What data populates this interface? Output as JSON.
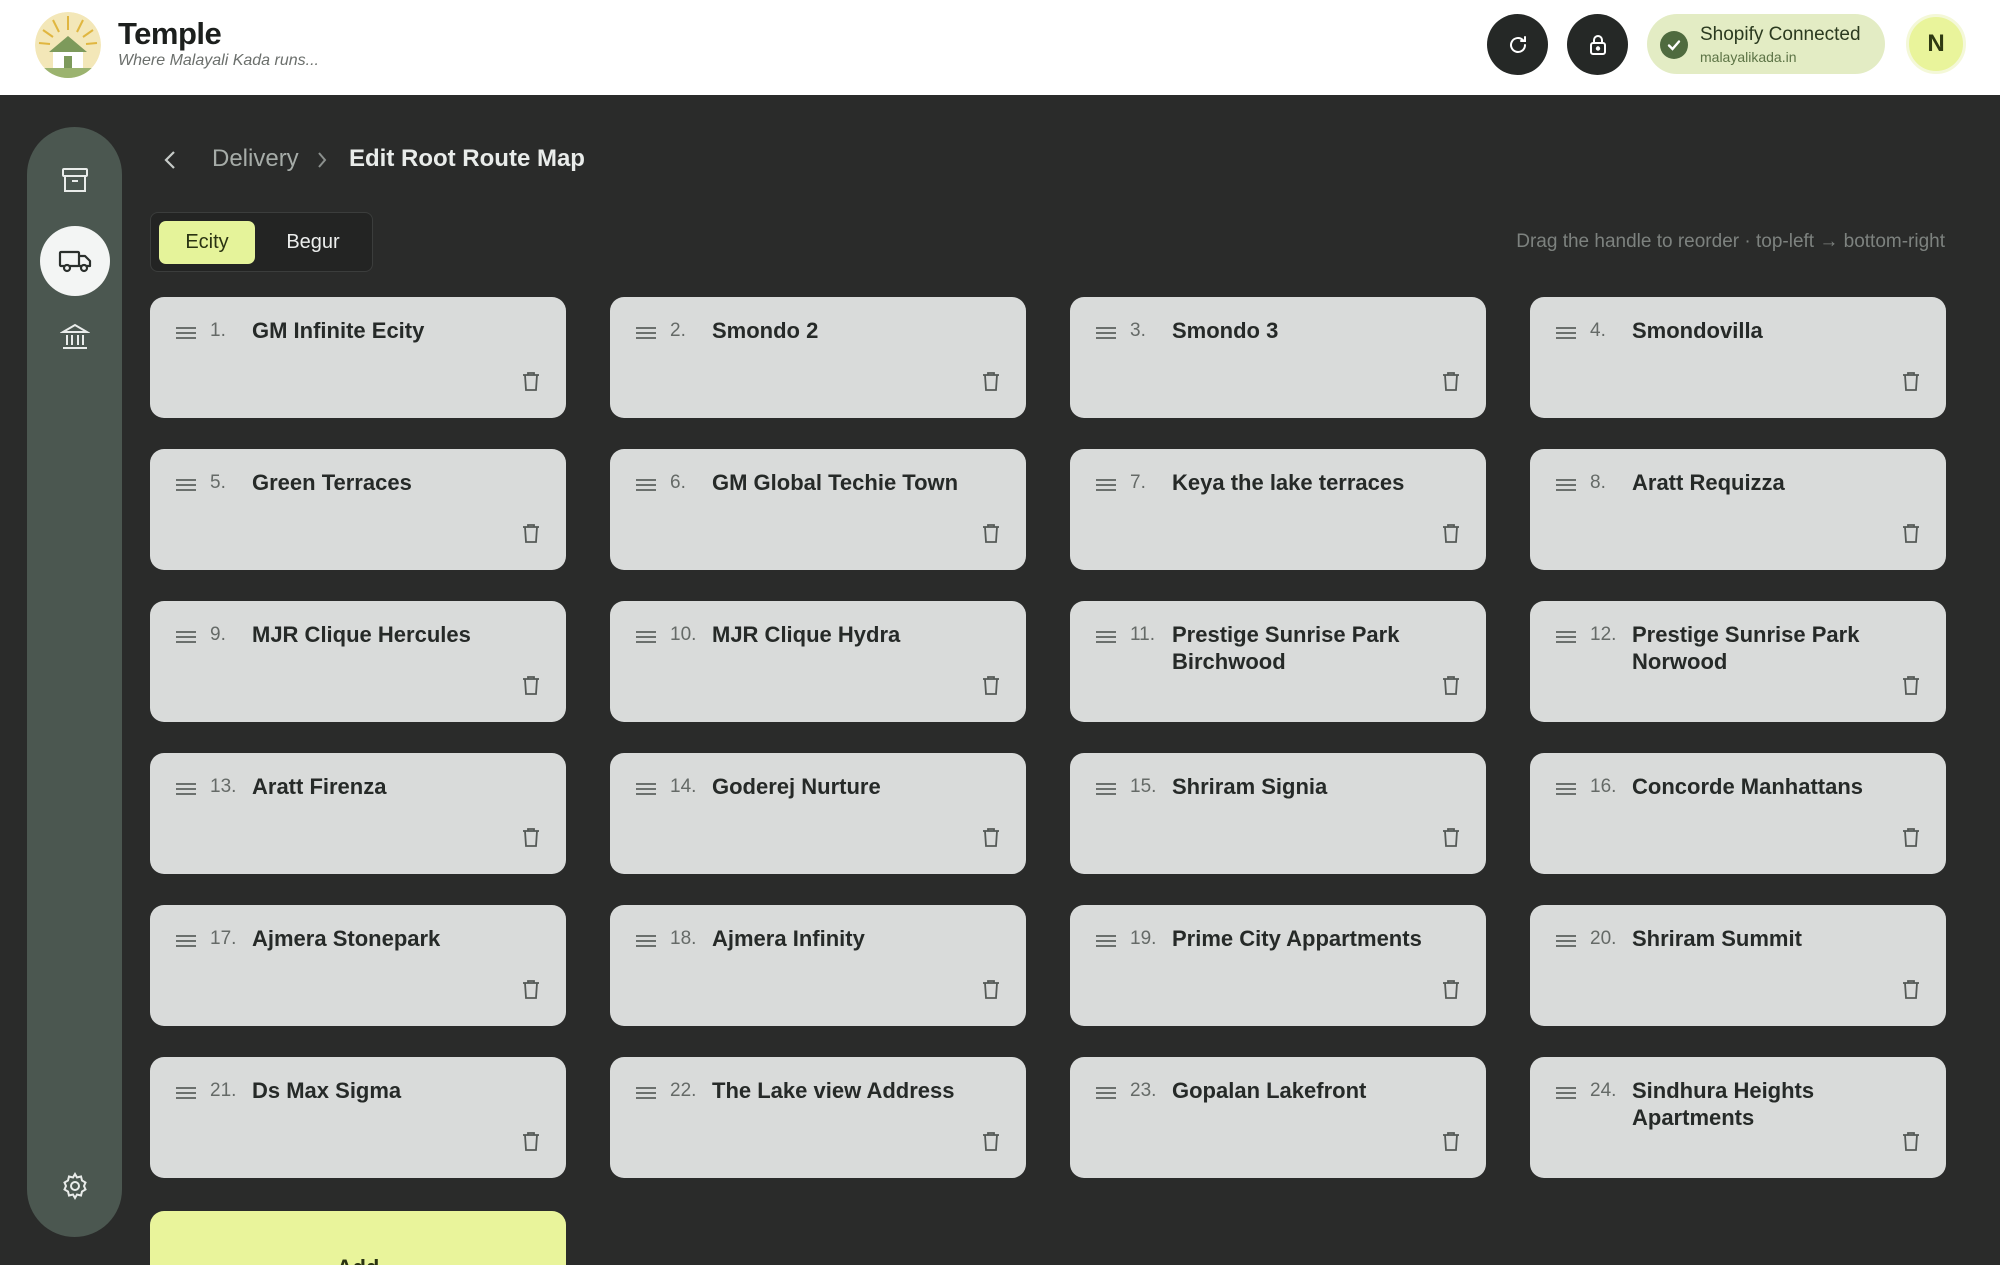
{
  "brand": {
    "title": "Temple",
    "tagline": "Where Malayali Kada runs..."
  },
  "shopify": {
    "status": "Shopify Connected",
    "domain": "malayalikada.in"
  },
  "user": {
    "initial": "N"
  },
  "breadcrumb": {
    "parent": "Delivery",
    "current": "Edit Root Route Map"
  },
  "tabs": [
    {
      "label": "Ecity",
      "active": true
    },
    {
      "label": "Begur",
      "active": false
    }
  ],
  "hint": "Drag the handle to reorder · top-left → bottom-right",
  "stops": [
    {
      "num": "1.",
      "name": "GM Infinite Ecity"
    },
    {
      "num": "2.",
      "name": "Smondo 2"
    },
    {
      "num": "3.",
      "name": "Smondo 3"
    },
    {
      "num": "4.",
      "name": "Smondovilla"
    },
    {
      "num": "5.",
      "name": "Green Terraces"
    },
    {
      "num": "6.",
      "name": "GM Global Techie Town"
    },
    {
      "num": "7.",
      "name": "Keya the lake terraces"
    },
    {
      "num": "8.",
      "name": "Aratt Requizza"
    },
    {
      "num": "9.",
      "name": "MJR Clique Hercules"
    },
    {
      "num": "10.",
      "name": "MJR Clique Hydra"
    },
    {
      "num": "11.",
      "name": "Prestige Sunrise Park Birchwood"
    },
    {
      "num": "12.",
      "name": "Prestige Sunrise Park Norwood"
    },
    {
      "num": "13.",
      "name": "Aratt Firenza"
    },
    {
      "num": "14.",
      "name": "Goderej Nurture"
    },
    {
      "num": "15.",
      "name": "Shriram Signia"
    },
    {
      "num": "16.",
      "name": "Concorde Manhattans"
    },
    {
      "num": "17.",
      "name": "Ajmera Stonepark"
    },
    {
      "num": "18.",
      "name": "Ajmera Infinity"
    },
    {
      "num": "19.",
      "name": "Prime City Appartments"
    },
    {
      "num": "20.",
      "name": "Shriram Summit"
    },
    {
      "num": "21.",
      "name": "Ds Max Sigma"
    },
    {
      "num": "22.",
      "name": "The Lake view Address"
    },
    {
      "num": "23.",
      "name": "Gopalan Lakefront"
    },
    {
      "num": "24.",
      "name": "Sindhura Heights Apartments"
    }
  ],
  "add_label": "Add",
  "icons": {
    "refresh": "refresh-icon",
    "lock": "lock-icon",
    "check": "check-icon",
    "archive": "archive-icon",
    "truck": "truck-icon",
    "bank": "bank-icon",
    "settings": "gear-icon",
    "drag": "drag-handle-icon",
    "trash": "trash-icon"
  },
  "colors": {
    "accent": "#e5f39a",
    "background": "#2a2b2a",
    "card": "#d9dbda",
    "sidebar": "#4b5750"
  }
}
